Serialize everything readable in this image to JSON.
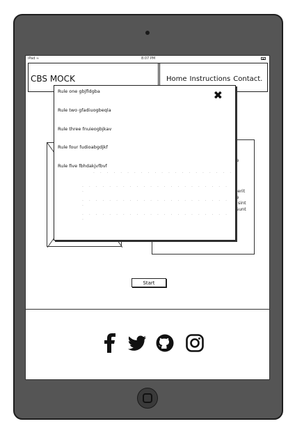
{
  "device": {
    "status_left": "iPad",
    "time": "8:07 PM"
  },
  "header": {
    "brand": "CBS MOCK",
    "nav": [
      "Home",
      "Instructions",
      "Contact."
    ]
  },
  "modal": {
    "close_label": "✖",
    "rules": [
      "Rule one  gbjfldgba",
      "Rule two gfadiuogbeqla",
      "Rule three fnuieogbjkav",
      "Rule four fudioabgdjkf",
      "Rule five fbhdakjvfbvf"
    ]
  },
  "content": {
    "right_card_text": [
      "do",
      "ore",
      "ad",
      "",
      "ut",
      "at.",
      "nderit",
      "ore",
      "ur sint",
      "t, sunt",
      "it"
    ]
  },
  "start_label": "Start",
  "social_icons": [
    "facebook-icon",
    "twitter-icon",
    "github-icon",
    "instagram-icon"
  ]
}
